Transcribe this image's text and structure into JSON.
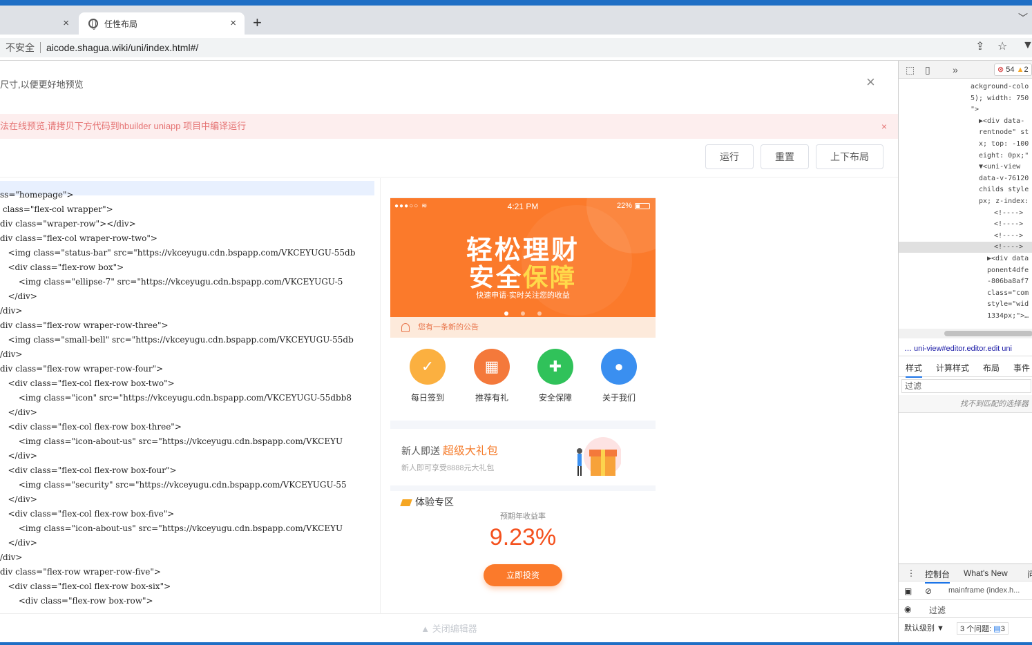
{
  "browser": {
    "tabs": [
      {
        "label": "",
        "close": "×"
      },
      {
        "label": "任性布局",
        "close": "×"
      }
    ],
    "new_tab": "+",
    "insecure_label": "不安全",
    "url": "aicode.shagua.wiki/uni/index.html#/"
  },
  "dialog": {
    "tip": "尺寸,以便更好地预览",
    "close": "×",
    "warning": "法在线预览,请拷贝下方代码到hbuilder uniapp 项目中编译运行",
    "warning_close": "×",
    "buttons": {
      "run": "运行",
      "reset": "重置",
      "layout": "上下布局"
    },
    "close_editor": "关闭编辑器"
  },
  "code_lines": [
    "ss=\"homepage\">",
    " class=\"flex-col wrapper\">",
    "div class=\"wraper-row\"></div>",
    "div class=\"flex-col wraper-row-two\">",
    "   <img class=\"status-bar\" src=\"https://vkceyugu.cdn.bspapp.com/VKCEYUGU-55db",
    "   <div class=\"flex-row box\">",
    "       <img class=\"ellipse-7\" src=\"https://vkceyugu.cdn.bspapp.com/VKCEYUGU-5",
    "   </div>",
    "/div>",
    "div class=\"flex-row wraper-row-three\">",
    "   <img class=\"small-bell\" src=\"https://vkceyugu.cdn.bspapp.com/VKCEYUGU-55db",
    "/div>",
    "div class=\"flex-row wraper-row-four\">",
    "   <div class=\"flex-col flex-row box-two\">",
    "       <img class=\"icon\" src=\"https://vkceyugu.cdn.bspapp.com/VKCEYUGU-55dbb8",
    "   </div>",
    "   <div class=\"flex-col flex-row box-three\">",
    "       <img class=\"icon-about-us\" src=\"https://vkceyugu.cdn.bspapp.com/VKCEYU",
    "   </div>",
    "   <div class=\"flex-col flex-row box-four\">",
    "       <img class=\"security\" src=\"https://vkceyugu.cdn.bspapp.com/VKCEYUGU-55",
    "   </div>",
    "   <div class=\"flex-col flex-row box-five\">",
    "       <img class=\"icon-about-us\" src=\"https://vkceyugu.cdn.bspapp.com/VKCEYU",
    "   </div>",
    "/div>",
    "div class=\"flex-row wraper-row-five\">",
    "   <div class=\"flex-col flex-row box-six\">",
    "       <div class=\"flex-row box-row\">"
  ],
  "phone": {
    "status_time": "4:21 PM",
    "status_battery": "22%",
    "banner_line1": "轻松理财",
    "banner_line2a": "安全",
    "banner_line2b": "保障",
    "banner_sub": "快速申请·实时关注您的收益",
    "notice": "您有一条新的公告",
    "grid": [
      {
        "label": "每日签到",
        "color": "#fbb040"
      },
      {
        "label": "推荐有礼",
        "color": "#f4793b"
      },
      {
        "label": "安全保障",
        "color": "#30c25a"
      },
      {
        "label": "关于我们",
        "color": "#3a8ff0"
      }
    ],
    "gift_title_a": "新人即送",
    "gift_title_b": "超级大礼包",
    "gift_sub": "新人即可享受8888元大礼包",
    "exp_title": "体验专区",
    "rate_label": "预期年收益率",
    "rate": "9.23%",
    "invest": "立即投资",
    "accent": "#fb7a2b"
  },
  "devtools": {
    "errors": "54",
    "warnings": "2",
    "dom_lines": [
      "ackground-colo",
      "5); width: 750",
      "\">",
      "▶<div data-",
      "rentnode\" st",
      "x; top: -100",
      "eight: 0px;\"",
      "▼<uni-view",
      "data-v-76120",
      "childs style",
      "px; z-index:",
      "<!---->",
      "<!---->",
      "<!---->",
      "<!---->",
      "▶<div data",
      "ponent4dfe",
      "-806ba8af7",
      "class=\"com",
      "style=\"wid",
      "1334px;\">…"
    ],
    "breadcrumb": "…  uni-view#editor.editor.edit   uni",
    "style_tabs": [
      "样式",
      "计算样式",
      "布局",
      "事件"
    ],
    "filter": "过滤",
    "no_match": "找不到匹配的选择器",
    "console_tabs": [
      "控制台",
      "What's New",
      "问"
    ],
    "context": "mainframe (index.h...",
    "filter2": "过滤",
    "levels": "默认级别 ▼",
    "issues": "3 个问题:",
    "issue_count": "3"
  }
}
